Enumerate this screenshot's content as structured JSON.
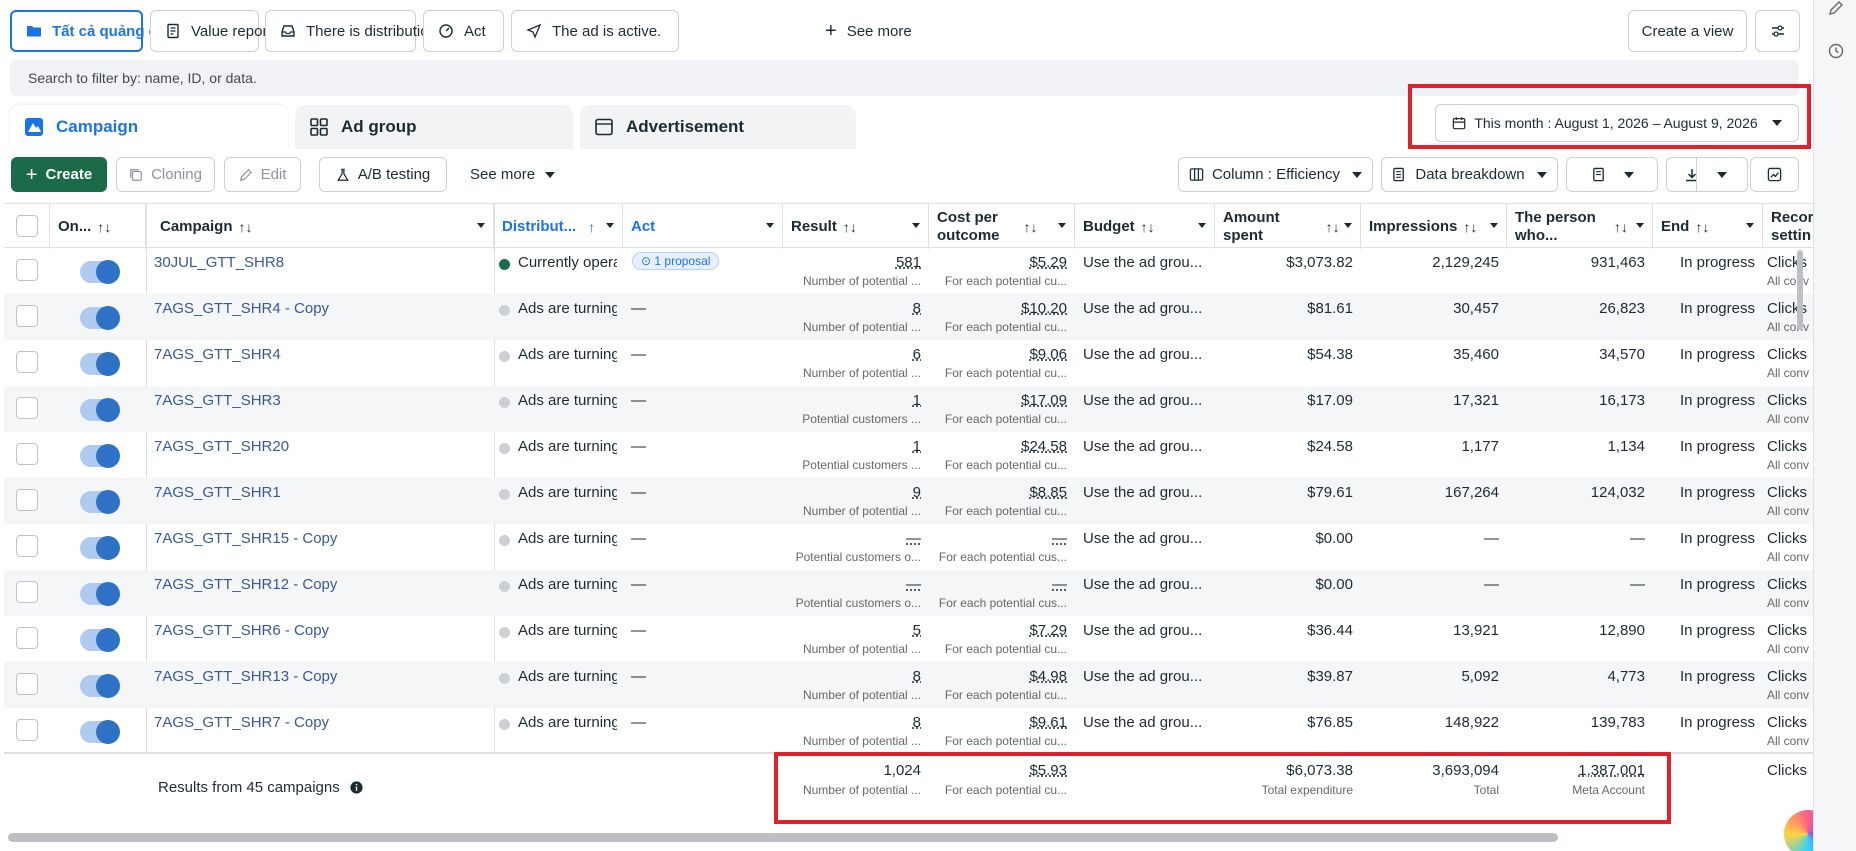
{
  "topbar": {
    "chips": [
      {
        "label": "Tất cả quảng cáo",
        "icon": "folder-icon"
      },
      {
        "label": "Value report",
        "icon": "report-icon"
      },
      {
        "label": "There is distribution",
        "icon": "inbox-icon"
      },
      {
        "label": "Act",
        "icon": "gauge-icon"
      },
      {
        "label": "The ad is active.",
        "icon": "send-icon"
      }
    ],
    "see_more": "See more",
    "create_view": "Create a view"
  },
  "filter": {
    "placeholder": "Search to filter by: name, ID, or data."
  },
  "level_tabs": {
    "campaign": "Campaign",
    "ad_group": "Ad group",
    "advertisement": "Advertisement"
  },
  "date_range": "This month : August 1, 2026 – August 9, 2026",
  "toolbar": {
    "create": "Create",
    "cloning": "Cloning",
    "edit": "Edit",
    "ab_testing": "A/B testing",
    "see_more": "See more",
    "columns": "Column : Efficiency",
    "breakdown": "Data breakdown"
  },
  "columns": {
    "on_off": "On...",
    "campaign": "Campaign",
    "distribution": "Distribut...",
    "act": "Act",
    "result": "Result",
    "cost_per_outcome_1": "Cost per",
    "cost_per_outcome_2": "outcome",
    "budget": "Budget",
    "amount_spent_1": "Amount",
    "amount_spent_2": "spent",
    "impressions": "Impressions",
    "reach_1": "The person",
    "reach_2": "who...",
    "end": "End",
    "record_1": "Recor",
    "record_2": "settin"
  },
  "rows": [
    {
      "name": "30JUL_GTT_SHR8",
      "status": "Currently operating",
      "active": true,
      "act": "1 proposal",
      "result": "581",
      "result_sub": "Number of potential ...",
      "cost": "$5.29",
      "cost_sub": "For each potential cu...",
      "budget": "Use the ad grou...",
      "spent": "$3,073.82",
      "impressions": "2,129,245",
      "reach": "931,463",
      "end": "In progress",
      "rec": "Clicks",
      "rec_sub": "All conv"
    },
    {
      "name": "7AGS_GTT_SHR4 - Copy",
      "status": "Ads are turning off",
      "active": false,
      "act": "—",
      "result": "8",
      "result_sub": "Number of potential ...",
      "cost": "$10.20",
      "cost_sub": "For each potential cu...",
      "budget": "Use the ad grou...",
      "spent": "$81.61",
      "impressions": "30,457",
      "reach": "26,823",
      "end": "In progress",
      "rec": "Clicks",
      "rec_sub": "All conv"
    },
    {
      "name": "7AGS_GTT_SHR4",
      "status": "Ads are turning off",
      "active": false,
      "act": "—",
      "result": "6",
      "result_sub": "Number of potential ...",
      "cost": "$9.06",
      "cost_sub": "For each potential cu...",
      "budget": "Use the ad grou...",
      "spent": "$54.38",
      "impressions": "35,460",
      "reach": "34,570",
      "end": "In progress",
      "rec": "Clicks",
      "rec_sub": "All conv"
    },
    {
      "name": "7AGS_GTT_SHR3",
      "status": "Ads are turning off",
      "active": false,
      "act": "—",
      "result": "1",
      "result_sub": "Potential customers ...",
      "cost": "$17.09",
      "cost_sub": "For each potential cu...",
      "budget": "Use the ad grou...",
      "spent": "$17.09",
      "impressions": "17,321",
      "reach": "16,173",
      "end": "In progress",
      "rec": "Clicks",
      "rec_sub": "All conv"
    },
    {
      "name": "7AGS_GTT_SHR20",
      "status": "Ads are turning off",
      "active": false,
      "act": "—",
      "result": "1",
      "result_sub": "Potential customers ...",
      "cost": "$24.58",
      "cost_sub": "For each potential cu...",
      "budget": "Use the ad grou...",
      "spent": "$24.58",
      "impressions": "1,177",
      "reach": "1,134",
      "end": "In progress",
      "rec": "Clicks",
      "rec_sub": "All conv"
    },
    {
      "name": "7AGS_GTT_SHR1",
      "status": "Ads are turning off",
      "active": false,
      "act": "—",
      "result": "9",
      "result_sub": "Number of potential ...",
      "cost": "$8.85",
      "cost_sub": "For each potential cu...",
      "budget": "Use the ad grou...",
      "spent": "$79.61",
      "impressions": "167,264",
      "reach": "124,032",
      "end": "In progress",
      "rec": "Clicks",
      "rec_sub": "All conv"
    },
    {
      "name": "7AGS_GTT_SHR15 - Copy",
      "status": "Ads are turning off",
      "active": false,
      "act": "—",
      "result": "—",
      "result_sub": "Potential customers o...",
      "cost": "—",
      "cost_sub": "For each potential cus...",
      "budget": "Use the ad grou...",
      "spent": "$0.00",
      "impressions": "—",
      "reach": "—",
      "end": "In progress",
      "rec": "Clicks",
      "rec_sub": "All conv"
    },
    {
      "name": "7AGS_GTT_SHR12 - Copy",
      "status": "Ads are turning off",
      "active": false,
      "act": "—",
      "result": "—",
      "result_sub": "Potential customers o...",
      "cost": "—",
      "cost_sub": "For each potential cus...",
      "budget": "Use the ad grou...",
      "spent": "$0.00",
      "impressions": "—",
      "reach": "—",
      "end": "In progress",
      "rec": "Clicks",
      "rec_sub": "All conv"
    },
    {
      "name": "7AGS_GTT_SHR6 - Copy",
      "status": "Ads are turning off",
      "active": false,
      "act": "—",
      "result": "5",
      "result_sub": "Number of potential ...",
      "cost": "$7.29",
      "cost_sub": "For each potential cu...",
      "budget": "Use the ad grou...",
      "spent": "$36.44",
      "impressions": "13,921",
      "reach": "12,890",
      "end": "In progress",
      "rec": "Clicks",
      "rec_sub": "All conv"
    },
    {
      "name": "7AGS_GTT_SHR13 - Copy",
      "status": "Ads are turning off",
      "active": false,
      "act": "—",
      "result": "8",
      "result_sub": "Number of potential ...",
      "cost": "$4.98",
      "cost_sub": "For each potential cu...",
      "budget": "Use the ad grou...",
      "spent": "$39.87",
      "impressions": "5,092",
      "reach": "4,773",
      "end": "In progress",
      "rec": "Clicks",
      "rec_sub": "All conv"
    },
    {
      "name": "7AGS_GTT_SHR7 - Copy",
      "status": "Ads are turning off",
      "active": false,
      "act": "—",
      "result": "8",
      "result_sub": "Number of potential ...",
      "cost": "$9.61",
      "cost_sub": "For each potential cu...",
      "budget": "Use the ad grou...",
      "spent": "$76.85",
      "impressions": "148,922",
      "reach": "139,783",
      "end": "In progress",
      "rec": "Clicks",
      "rec_sub": "All conv"
    }
  ],
  "totals": {
    "label": "Results from 45 campaigns",
    "result": "1,024",
    "result_sub": "Number of potential ...",
    "cost": "$5.93",
    "cost_sub": "For each potential cu...",
    "spent": "$6,073.38",
    "spent_sub": "Total expenditure",
    "impressions": "3,693,094",
    "impressions_sub": "Total",
    "reach": "1,387,001",
    "reach_sub": "Meta Account",
    "rec": "Clicks"
  },
  "colors": {
    "accent": "#1b74e4",
    "create": "#1b6a4a",
    "highlight": "#e0212b",
    "active_dot": "#1b6a4a"
  }
}
